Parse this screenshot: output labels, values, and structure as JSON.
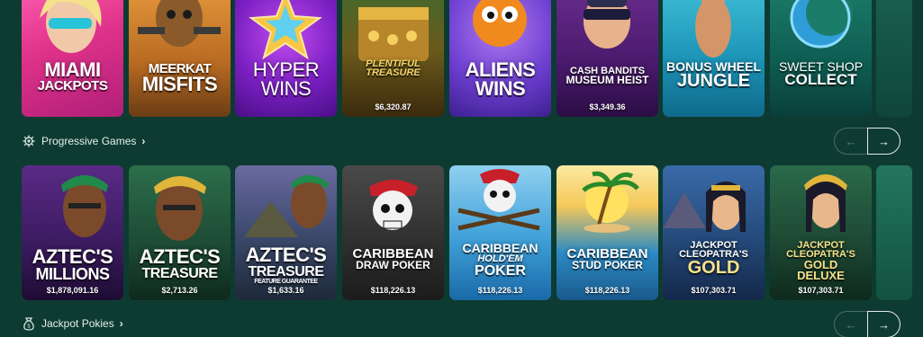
{
  "games_row_top": [
    {
      "title_lines": [
        "Miami",
        "Jackpots"
      ],
      "amount": ""
    },
    {
      "title_lines": [
        "Meerkat",
        "Misfits"
      ],
      "amount": ""
    },
    {
      "title_lines": [
        "Hyper",
        "Wins"
      ],
      "amount": ""
    },
    {
      "title_lines": [
        "Plentiful",
        "Treasure"
      ],
      "amount": "$6,320.87"
    },
    {
      "title_lines": [
        "Aliens",
        "Wins"
      ],
      "amount": ""
    },
    {
      "title_lines": [
        "Cash Bandits",
        "Museum Heist"
      ],
      "amount": "$3,349.36"
    },
    {
      "title_lines": [
        "Bonus Wheel",
        "Jungle"
      ],
      "amount": ""
    },
    {
      "title_lines": [
        "Sweet Shop",
        "Collect"
      ],
      "amount": ""
    }
  ],
  "progressive": {
    "label": "Progressive Games",
    "prev_icon": "←",
    "next_icon": "→",
    "games": [
      {
        "title_lines": [
          "Aztec's",
          "Millions"
        ],
        "amount": "$1,878,091.16"
      },
      {
        "title_lines": [
          "Aztec's",
          "Treasure"
        ],
        "amount": "$2,713.26"
      },
      {
        "title_lines": [
          "Aztec's",
          "Treasure",
          "Feature Guarantee"
        ],
        "amount": "$1,633.16"
      },
      {
        "title_lines": [
          "Caribbean",
          "Draw Poker"
        ],
        "amount": "$118,226.13"
      },
      {
        "title_lines": [
          "Caribbean",
          "Hold'em",
          "Poker"
        ],
        "amount": "$118,226.13"
      },
      {
        "title_lines": [
          "Caribbean",
          "Stud Poker"
        ],
        "amount": "$118,226.13"
      },
      {
        "title_lines": [
          "Jackpot",
          "Cleopatra's",
          "Gold"
        ],
        "amount": "$107,303.71"
      },
      {
        "title_lines": [
          "Jackpot",
          "Cleopatra's",
          "Gold",
          "Deluxe"
        ],
        "amount": "$107,303.71"
      }
    ]
  },
  "jackpot_pokies": {
    "label": "Jackpot Pokies",
    "prev_icon": "←",
    "next_icon": "→"
  },
  "colors": {
    "background": "#0d3b32",
    "text": "#e6f0ec"
  }
}
